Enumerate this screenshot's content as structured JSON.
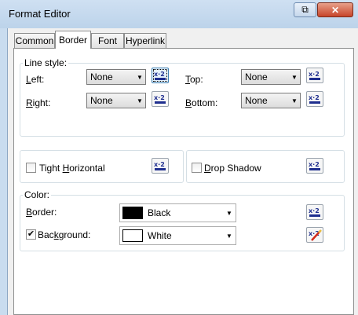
{
  "window": {
    "title": "Format Editor",
    "restore_glyph": "⧉",
    "close_glyph": "✕"
  },
  "tabs": [
    {
      "label": "Common",
      "active": false
    },
    {
      "label": "Border",
      "active": true
    },
    {
      "label": "Font",
      "active": false
    },
    {
      "label": "Hyperlink",
      "active": false
    }
  ],
  "line_style": {
    "group_label": "Line style:",
    "left": {
      "label_prefix": "",
      "accel": "L",
      "label_rest": "eft:",
      "value": "None"
    },
    "top": {
      "label_prefix": "",
      "accel": "T",
      "label_rest": "op:",
      "value": "None"
    },
    "right": {
      "label_prefix": "",
      "accel": "R",
      "label_rest": "ight:",
      "value": "None"
    },
    "bottom": {
      "label_prefix": "",
      "accel": "B",
      "label_rest": "ottom:",
      "value": "None"
    }
  },
  "options": {
    "tight_horizontal": {
      "label_prefix": "Tight ",
      "accel": "H",
      "label_rest": "orizontal",
      "checked": false
    },
    "drop_shadow": {
      "label_prefix": "",
      "accel": "D",
      "label_rest": "rop Shadow",
      "checked": false
    }
  },
  "color": {
    "group_label": "Color:",
    "border": {
      "label_prefix": "",
      "accel": "B",
      "label_rest": "order:",
      "value": "Black",
      "swatch": "#000000"
    },
    "background": {
      "label_prefix": "Bac",
      "accel": "k",
      "label_rest": "ground:",
      "value": "White",
      "swatch": "#ffffff",
      "checked": true
    }
  },
  "icons": {
    "expression": "x-2-expression-icon",
    "expression_active": "x-2-expression-edit-icon",
    "dropdown": "chevron-down-icon"
  },
  "colors": {
    "expr_blue": "#1f2f8f",
    "active_pencil": "#d42a1a"
  }
}
